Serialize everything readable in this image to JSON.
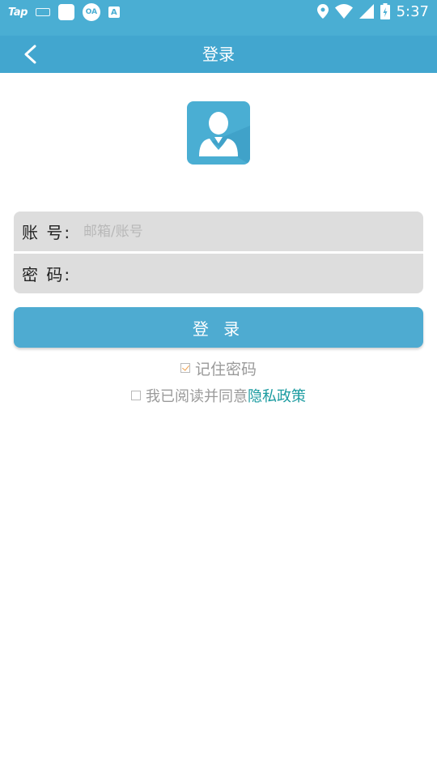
{
  "status_bar": {
    "left_app": "Tap",
    "circle_badge": "OA",
    "a_badge": "A",
    "time": "5:37"
  },
  "header": {
    "title": "登录"
  },
  "form": {
    "account_label": "账 号:",
    "account_placeholder": "邮箱/账号",
    "account_value": "",
    "password_label": "密 码:",
    "password_value": ""
  },
  "login_button": "登 录",
  "remember": {
    "label": "记住密码",
    "checked": true
  },
  "agreement": {
    "text": "我已阅读并同意",
    "link": "隐私政策",
    "checked": false
  },
  "colors": {
    "status_bar": "#4aaed3",
    "title_bar": "#42a6cf",
    "button": "#4eabd1",
    "link": "#1a9ba0",
    "check_mark": "#f0a04b"
  }
}
